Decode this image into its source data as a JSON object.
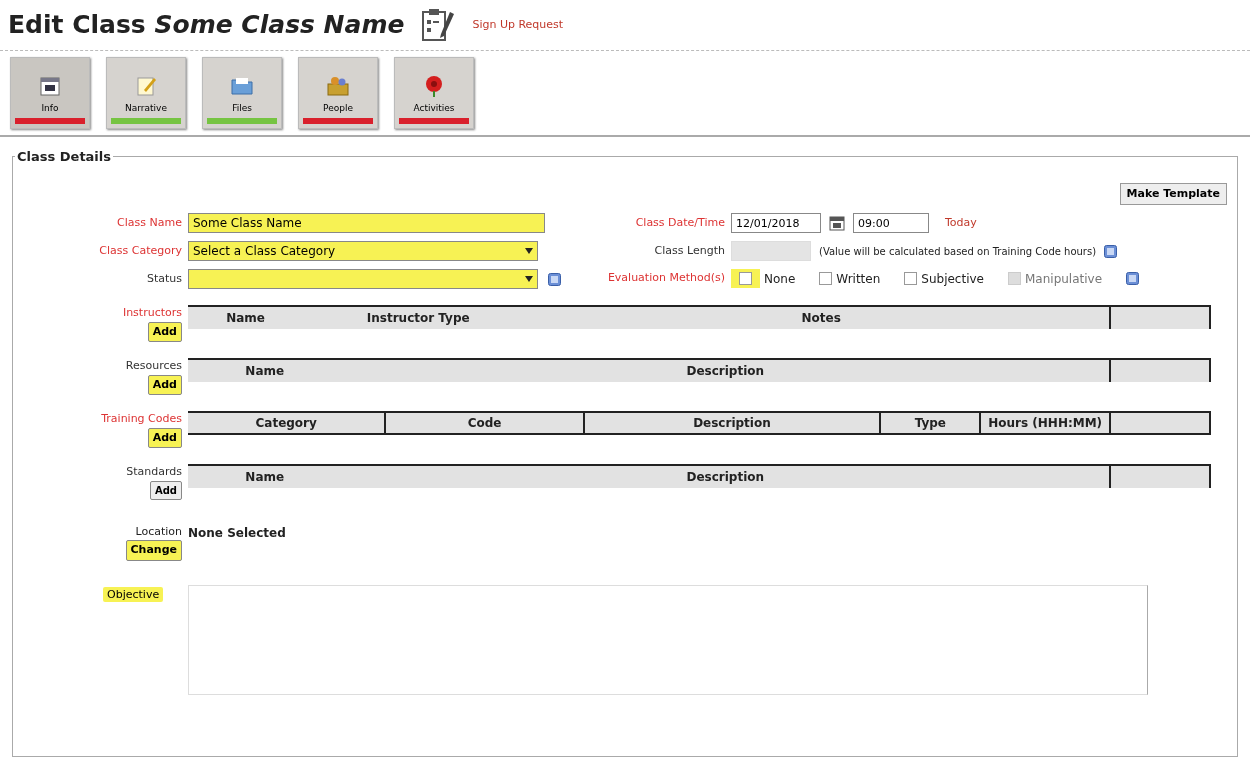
{
  "page_title": {
    "prefix": "Edit Class",
    "class_name": "Some Class Name"
  },
  "sign_up_link": "Sign Up Request",
  "tabs": [
    {
      "label": "Info",
      "kind": "calendar",
      "selected": true,
      "color": "#d9202c"
    },
    {
      "label": "Narrative",
      "kind": "notepad",
      "selected": false,
      "color": "#76c442"
    },
    {
      "label": "Files",
      "kind": "folder",
      "selected": false,
      "color": "#76c442"
    },
    {
      "label": "People",
      "kind": "people",
      "selected": false,
      "color": "#d9202c"
    },
    {
      "label": "Activities",
      "kind": "flower",
      "selected": false,
      "color": "#d9202c"
    }
  ],
  "section": {
    "legend": "Class Details",
    "template_button": "Make Template"
  },
  "class_name": {
    "label": "Class Name",
    "required": true,
    "value": "Some Class Name",
    "highlighted": true
  },
  "class_category": {
    "label": "Class Category",
    "required": true,
    "value": "Select a Class Category",
    "highlighted": true
  },
  "status": {
    "label": "Status",
    "required": false,
    "highlighted": true
  },
  "class_datetime": {
    "label": "Class Date/Time",
    "required": true,
    "date": "12/01/2018",
    "time": "09:00",
    "today_link": "Today"
  },
  "class_length": {
    "label": "Class Length",
    "required": false,
    "disabled": true,
    "note": "(Value will be calculated based on Training Code hours)"
  },
  "evaluation": {
    "label": "Evaluation Method(s)",
    "required": true,
    "options": [
      {
        "label": "None",
        "checked": false,
        "highlighted": true,
        "disabled": false
      },
      {
        "label": "Written",
        "checked": false,
        "highlighted": false,
        "disabled": false
      },
      {
        "label": "Subjective",
        "checked": false,
        "highlighted": false,
        "disabled": false
      },
      {
        "label": "Manipulative",
        "checked": false,
        "highlighted": false,
        "disabled": true
      }
    ]
  },
  "grids": [
    {
      "label": "Instructors",
      "required": true,
      "add_button": "Add",
      "add_highlighted": true,
      "column_dividers": false,
      "columns": [
        "Name",
        "Instructor Type",
        "Notes"
      ]
    },
    {
      "label": "Resources",
      "required": false,
      "add_button": "Add",
      "add_highlighted": true,
      "column_dividers": false,
      "columns": [
        "Name",
        "Description"
      ]
    },
    {
      "label": "Training Codes",
      "required": true,
      "add_button": "Add",
      "add_highlighted": true,
      "column_dividers": true,
      "columns": [
        "Category",
        "Code",
        "Description",
        "Type",
        "Hours (HHH:MM)"
      ]
    },
    {
      "label": "Standards",
      "required": false,
      "add_button": "Add",
      "add_highlighted": false,
      "column_dividers": false,
      "columns": [
        "Name",
        "Description"
      ]
    }
  ],
  "location": {
    "label": "Location",
    "value": "None Selected",
    "change_button": "Change"
  },
  "objective": {
    "label": "Objective",
    "highlighted": true
  }
}
